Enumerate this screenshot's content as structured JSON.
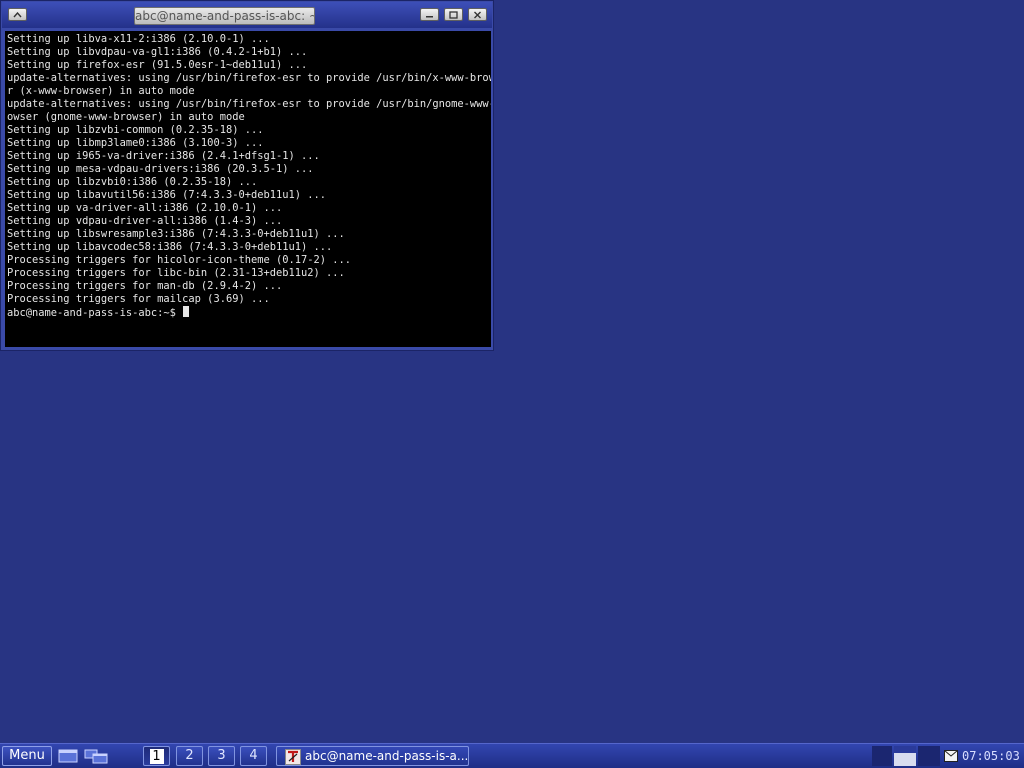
{
  "window": {
    "title": "abc@name-and-pass-is-abc: ~",
    "lines": [
      "Setting up libva-x11-2:i386 (2.10.0-1) ...",
      "Setting up libvdpau-va-gl1:i386 (0.4.2-1+b1) ...",
      "Setting up firefox-esr (91.5.0esr-1~deb11u1) ...",
      "update-alternatives: using /usr/bin/firefox-esr to provide /usr/bin/x-www-browse",
      "r (x-www-browser) in auto mode",
      "update-alternatives: using /usr/bin/firefox-esr to provide /usr/bin/gnome-www-br",
      "owser (gnome-www-browser) in auto mode",
      "Setting up libzvbi-common (0.2.35-18) ...",
      "Setting up libmp3lame0:i386 (3.100-3) ...",
      "Setting up i965-va-driver:i386 (2.4.1+dfsg1-1) ...",
      "Setting up mesa-vdpau-drivers:i386 (20.3.5-1) ...",
      "Setting up libzvbi0:i386 (0.2.35-18) ...",
      "Setting up libavutil56:i386 (7:4.3.3-0+deb11u1) ...",
      "Setting up va-driver-all:i386 (2.10.0-1) ...",
      "Setting up vdpau-driver-all:i386 (1.4-3) ...",
      "Setting up libswresample3:i386 (7:4.3.3-0+deb11u1) ...",
      "Setting up libavcodec58:i386 (7:4.3.3-0+deb11u1) ...",
      "Processing triggers for hicolor-icon-theme (0.17-2) ...",
      "Processing triggers for libc-bin (2.31-13+deb11u2) ...",
      "Processing triggers for man-db (2.9.4-2) ...",
      "Processing triggers for mailcap (3.69) ..."
    ],
    "prompt": "abc@name-and-pass-is-abc:~$ "
  },
  "taskbar": {
    "menu_label": "Menu",
    "workspaces": [
      "1",
      "2",
      "3",
      "4"
    ],
    "active_workspace": "1",
    "task_label": "abc@name-and-pass-is-a...",
    "clock": "07:05:03"
  },
  "colors": {
    "desktop": "#283483",
    "terminal_bg": "#000000",
    "terminal_fg": "#e6e6e6"
  },
  "icons": [
    "window-menu-icon",
    "minimize-icon",
    "maximize-icon",
    "close-icon",
    "show-desktop-icon",
    "window-list-icon",
    "terminal-app-icon",
    "mail-icon"
  ]
}
